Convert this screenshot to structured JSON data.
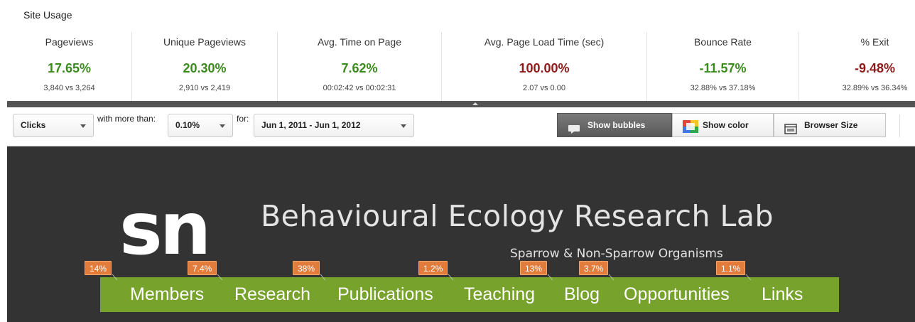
{
  "usage": {
    "title": "Site Usage",
    "metrics": [
      {
        "label": "Pageviews",
        "value": "17.65%",
        "compare": "3,840 vs 3,264",
        "trend": "positive"
      },
      {
        "label": "Unique Pageviews",
        "value": "20.30%",
        "compare": "2,910 vs 2,419",
        "trend": "positive"
      },
      {
        "label": "Avg. Time on Page",
        "value": "7.62%",
        "compare": "00:02:42 vs 00:02:31",
        "trend": "positive"
      },
      {
        "label": "Avg. Page Load Time (sec)",
        "value": "100.00%",
        "compare": "2.07 vs 0.00",
        "trend": "negative"
      },
      {
        "label": "Bounce Rate",
        "value": "-11.57%",
        "compare": "32.88% vs 37.18%",
        "trend": "positive"
      },
      {
        "label": "% Exit",
        "value": "-9.48%",
        "compare": "32.89% vs 36.34%",
        "trend": "negative"
      }
    ]
  },
  "toolbar": {
    "metric_select": "Clicks",
    "threshold_label": "with more than:",
    "threshold_select": "0.10%",
    "date_label": "for:",
    "date_select": "Jun 1, 2011 - Jun 1, 2012",
    "show_bubbles": "Show bubbles",
    "show_color": "Show color",
    "browser_size": "Browser Size"
  },
  "site": {
    "logo": "sn",
    "title": "Behavioural Ecology Research Lab",
    "subtitle": "Sparrow & Non-Sparrow Organisms",
    "nav": [
      "Members",
      "Research",
      "Publications",
      "Teaching",
      "Blog",
      "Opportunities",
      "Links"
    ]
  },
  "bubbles": [
    "14%",
    "7.4%",
    "38%",
    "1.2%",
    "13%",
    "3.7%",
    "1.1%"
  ],
  "colors": {
    "positive": "#3a8b1d",
    "negative": "#8f1a1a",
    "nav_bar": "#77a22b",
    "bubble": "#e27c3c",
    "preview_bg": "#333333"
  }
}
